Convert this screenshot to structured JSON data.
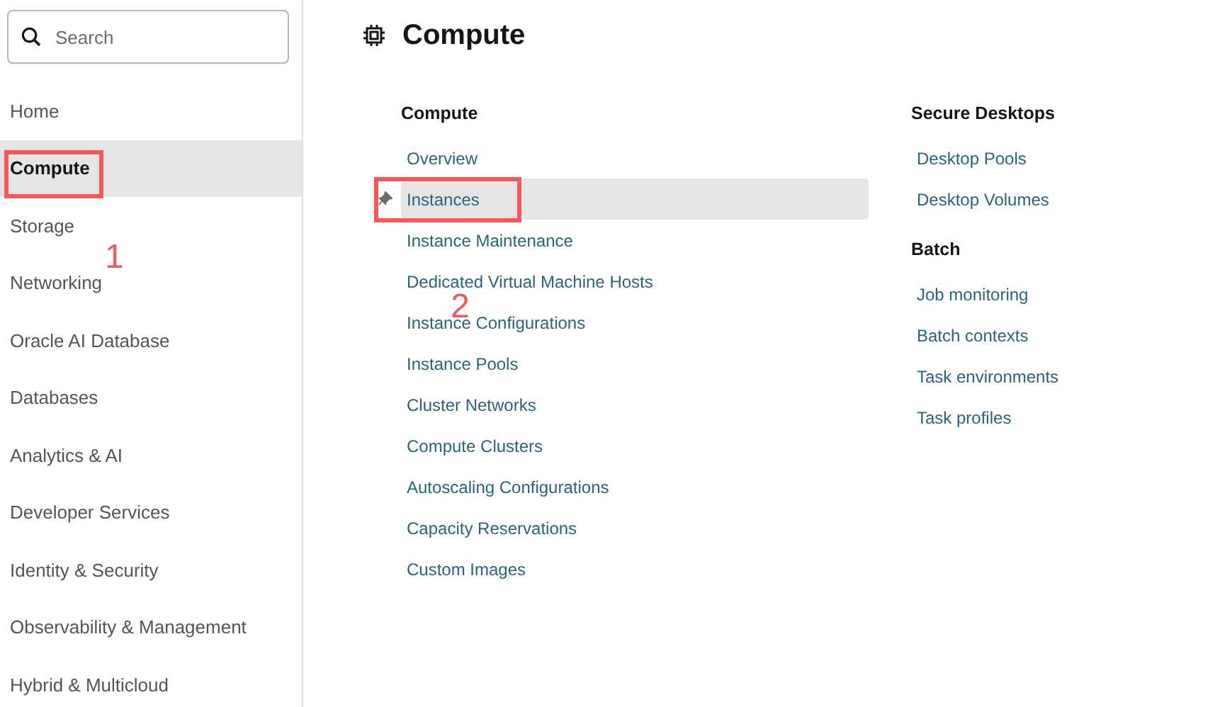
{
  "search": {
    "placeholder": "Search"
  },
  "sidebar": {
    "items": [
      {
        "label": "Home",
        "selected": false
      },
      {
        "label": "Compute",
        "selected": true,
        "callout": "1"
      },
      {
        "label": "Storage",
        "selected": false
      },
      {
        "label": "Networking",
        "selected": false
      },
      {
        "label": "Oracle AI Database",
        "selected": false
      },
      {
        "label": "Databases",
        "selected": false
      },
      {
        "label": "Analytics & AI",
        "selected": false
      },
      {
        "label": "Developer Services",
        "selected": false
      },
      {
        "label": "Identity & Security",
        "selected": false
      },
      {
        "label": "Observability & Management",
        "selected": false
      },
      {
        "label": "Hybrid & Multicloud",
        "selected": false
      }
    ]
  },
  "page": {
    "title": "Compute"
  },
  "columns": [
    {
      "groups": [
        {
          "heading": "Compute",
          "links": [
            {
              "label": "Overview",
              "selected": false
            },
            {
              "label": "Instances",
              "selected": true,
              "pinned": true,
              "callout": "2"
            },
            {
              "label": "Instance Maintenance",
              "selected": false
            },
            {
              "label": "Dedicated Virtual Machine Hosts",
              "selected": false
            },
            {
              "label": "Instance Configurations",
              "selected": false
            },
            {
              "label": "Instance Pools",
              "selected": false
            },
            {
              "label": "Cluster Networks",
              "selected": false
            },
            {
              "label": "Compute Clusters",
              "selected": false
            },
            {
              "label": "Autoscaling Configurations",
              "selected": false
            },
            {
              "label": "Capacity Reservations",
              "selected": false
            },
            {
              "label": "Custom Images",
              "selected": false
            }
          ]
        }
      ]
    },
    {
      "groups": [
        {
          "heading": "Secure Desktops",
          "links": [
            {
              "label": "Desktop Pools",
              "selected": false
            },
            {
              "label": "Desktop Volumes",
              "selected": false
            }
          ]
        },
        {
          "heading": "Batch",
          "links": [
            {
              "label": "Job monitoring",
              "selected": false
            },
            {
              "label": "Batch contexts",
              "selected": false
            },
            {
              "label": "Task environments",
              "selected": false
            },
            {
              "label": "Task profiles",
              "selected": false
            }
          ]
        }
      ]
    }
  ]
}
